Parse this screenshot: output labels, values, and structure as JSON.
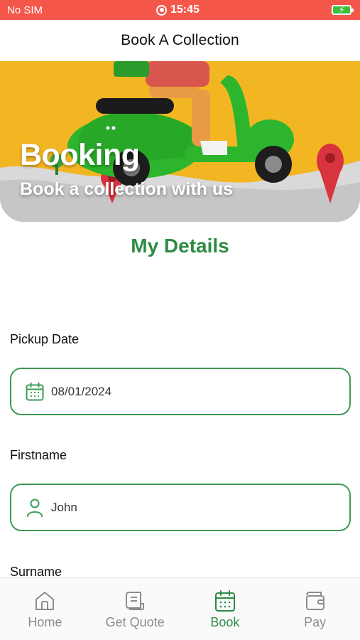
{
  "status_bar": {
    "carrier": "No SIM",
    "time": "15:45",
    "battery_icon": "battery-charging-icon",
    "record_icon": "screen-record-icon"
  },
  "header": {
    "title": "Book A Collection"
  },
  "banner": {
    "title": "Booking",
    "subtitle": "Book a collection with us",
    "background_color": "#f3b623"
  },
  "main": {
    "heading": "My Details",
    "fields": [
      {
        "label": "Pickup Date",
        "value": "08/01/2024",
        "icon": "calendar-icon"
      },
      {
        "label": "Firstname",
        "value": "John",
        "icon": "person-icon"
      },
      {
        "label": "Surname",
        "value": "",
        "icon": "person-icon"
      }
    ]
  },
  "tab_bar": {
    "tabs": [
      {
        "label": "Home",
        "icon": "home-icon",
        "active": false
      },
      {
        "label": "Get Quote",
        "icon": "receipt-icon",
        "active": false
      },
      {
        "label": "Book",
        "icon": "calendar-icon",
        "active": true
      },
      {
        "label": "Pay",
        "icon": "wallet-icon",
        "active": false
      }
    ]
  },
  "colors": {
    "accent_green": "#2e8b45",
    "status_bar_red": "#f4574a",
    "inactive_gray": "#8c8c8c"
  }
}
